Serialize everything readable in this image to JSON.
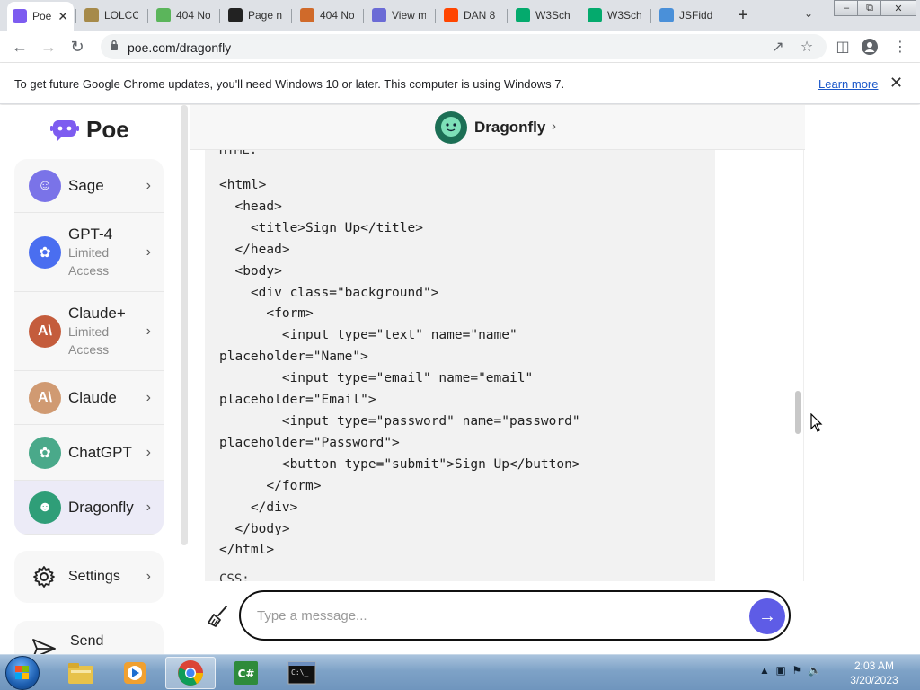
{
  "browser": {
    "tabs": [
      {
        "title": "Poe",
        "favicon": "poe-icon",
        "color": "#7d5cf0",
        "active": true
      },
      {
        "title": "LOLCO",
        "favicon": "lolcow-icon",
        "color": "#a68a4a",
        "active": false
      },
      {
        "title": "404 No",
        "favicon": "t-icon",
        "color": "#5bb55b",
        "active": false
      },
      {
        "title": "Page n",
        "favicon": "github-icon",
        "color": "#222222",
        "active": false
      },
      {
        "title": "404 No",
        "favicon": "feather-icon",
        "color": "#d06a2a",
        "active": false
      },
      {
        "title": "View m",
        "favicon": "at-icon",
        "color": "#6b6bd6",
        "active": false
      },
      {
        "title": "DAN 8",
        "favicon": "reddit-icon",
        "color": "#ff4500",
        "active": false
      },
      {
        "title": "W3Sch",
        "favicon": "w3schools-icon",
        "color": "#04aa6d",
        "active": false
      },
      {
        "title": "W3Sch",
        "favicon": "w3schools-icon",
        "color": "#04aa6d",
        "active": false
      },
      {
        "title": "JSFiddl",
        "favicon": "cloud-icon",
        "color": "#4a90d9",
        "active": false
      }
    ],
    "url": "poe.com/dragonfly",
    "infobar": {
      "message": "To get future Google Chrome updates, you'll need Windows 10 or later. This computer is using Windows 7.",
      "link": "Learn more"
    }
  },
  "sidebar": {
    "logo_text": "Poe",
    "bots": [
      {
        "name": "Sage",
        "sub": "",
        "icon": "sage-icon",
        "color": "#7a73e8",
        "selected": false
      },
      {
        "name": "GPT-4",
        "sub": "Limited Access",
        "icon": "openai-icon",
        "color": "#4a6ef0",
        "selected": false
      },
      {
        "name": "Claude+",
        "sub": "Limited Access",
        "icon": "anthropic-icon",
        "color": "#c45c3c",
        "selected": false
      },
      {
        "name": "Claude",
        "sub": "",
        "icon": "anthropic-icon",
        "color": "#d09a72",
        "selected": false
      },
      {
        "name": "ChatGPT",
        "sub": "",
        "icon": "openai-icon",
        "color": "#4aa98a",
        "selected": false
      },
      {
        "name": "Dragonfly",
        "sub": "",
        "icon": "dragonfly-icon",
        "color": "#2f9e78",
        "selected": true
      }
    ],
    "settings_label": "Settings",
    "send_label": "Send"
  },
  "chat": {
    "bot_name": "Dragonfly",
    "cut_top": "HTML:",
    "cut_bottom": "CSS:",
    "code": "<html>\n  <head>\n    <title>Sign Up</title>\n  </head>\n  <body>\n    <div class=\"background\">\n      <form>\n        <input type=\"text\" name=\"name\"\nplaceholder=\"Name\">\n        <input type=\"email\" name=\"email\"\nplaceholder=\"Email\">\n        <input type=\"password\" name=\"password\"\nplaceholder=\"Password\">\n        <button type=\"submit\">Sign Up</button>\n      </form>\n    </div>\n  </body>\n</html>",
    "input_placeholder": "Type a message..."
  },
  "taskbar": {
    "apps": [
      "explorer-icon",
      "media-player-icon",
      "chrome-icon",
      "csharp-icon",
      "cmd-icon"
    ],
    "time": "2:03 AM",
    "date": "3/20/2023"
  }
}
